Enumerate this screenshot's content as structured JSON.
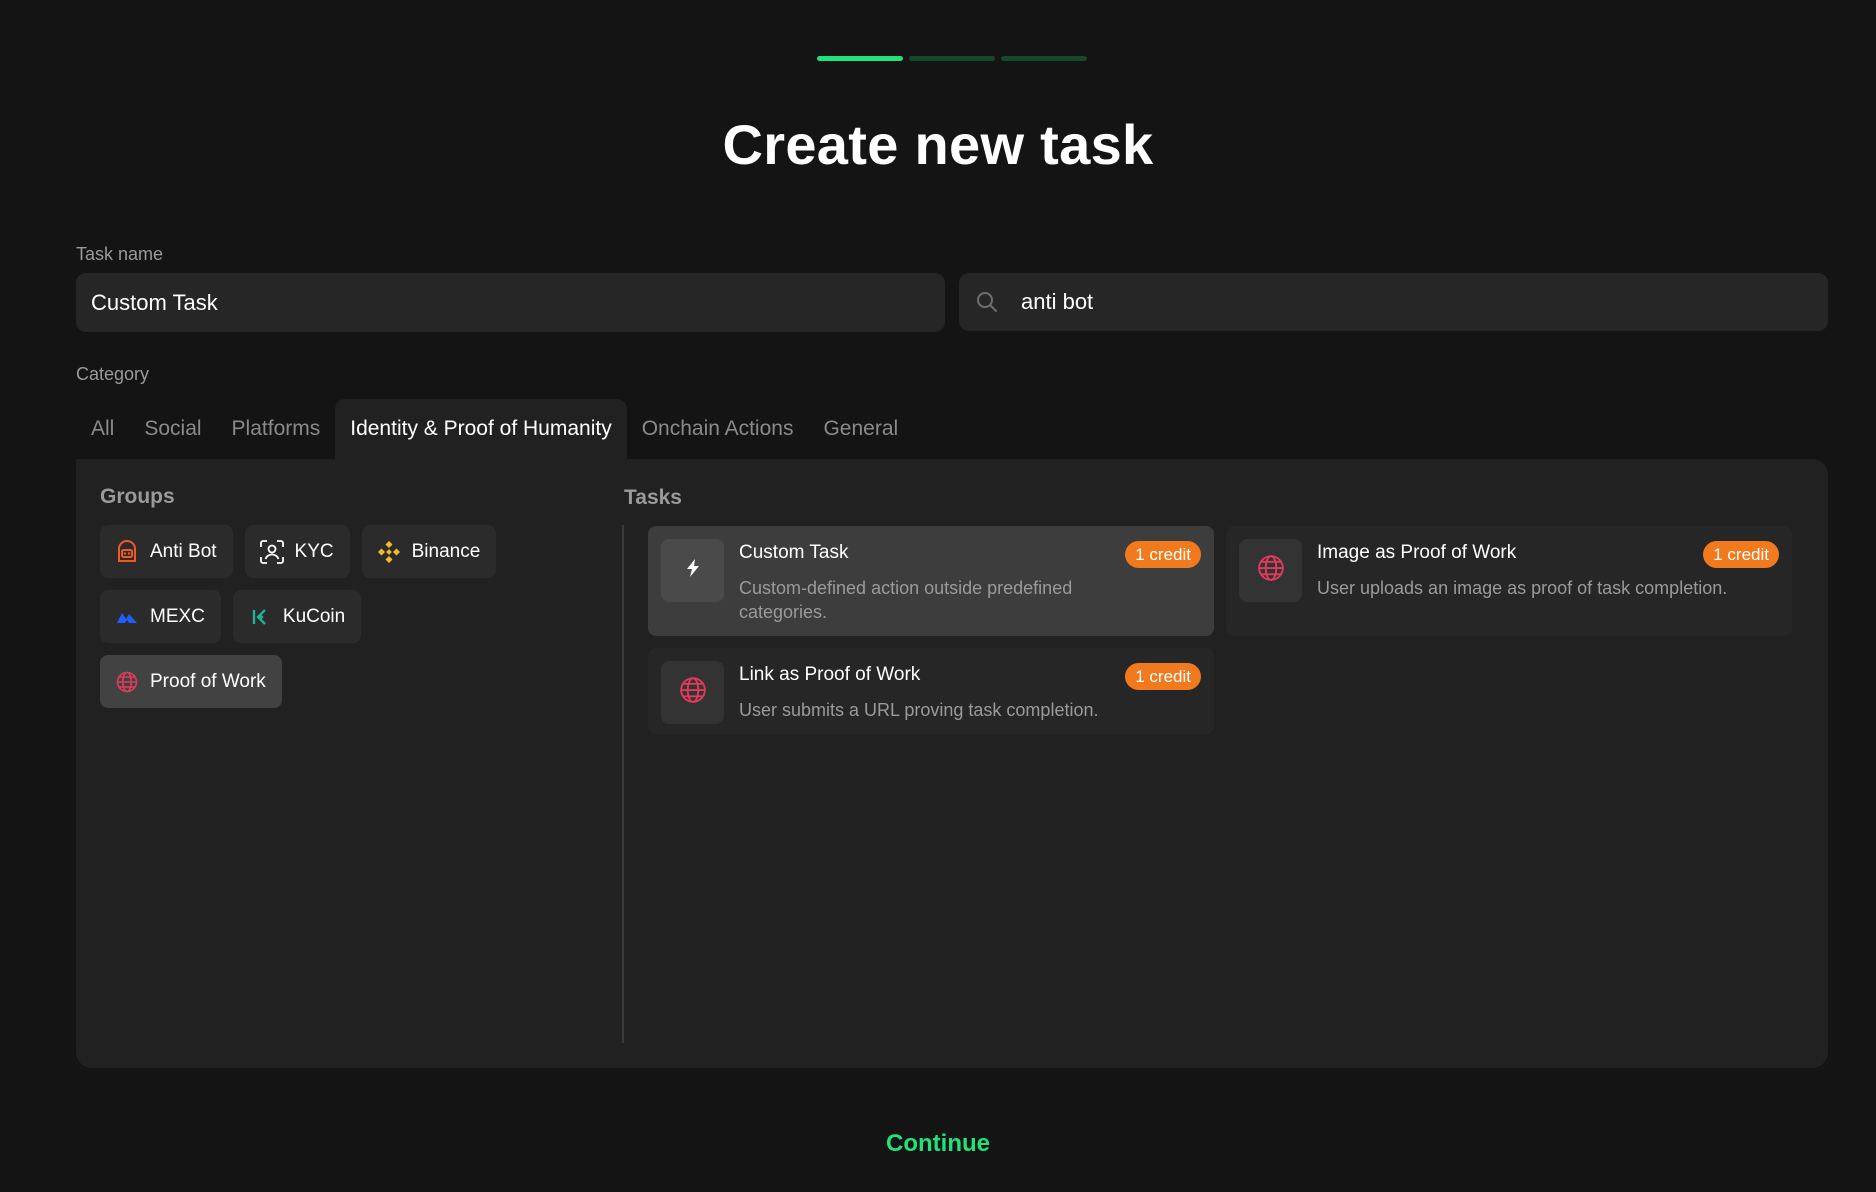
{
  "header": {
    "title": "Create new task",
    "progress_steps": [
      true,
      false,
      false
    ]
  },
  "form": {
    "task_name_label": "Task name",
    "task_name_value": "Custom Task",
    "search_value": "anti bot",
    "category_label": "Category"
  },
  "tabs": [
    {
      "label": "All",
      "active": false
    },
    {
      "label": "Social",
      "active": false
    },
    {
      "label": "Platforms",
      "active": false
    },
    {
      "label": "Identity & Proof of Humanity",
      "active": true
    },
    {
      "label": "Onchain Actions",
      "active": false
    },
    {
      "label": "General",
      "active": false
    }
  ],
  "groups": {
    "title": "Groups",
    "items": [
      {
        "label": "Anti Bot",
        "icon": "robot-icon",
        "active": false
      },
      {
        "label": "KYC",
        "icon": "face-scan-icon",
        "active": false
      },
      {
        "label": "Binance",
        "icon": "binance-icon",
        "active": false
      },
      {
        "label": "MEXC",
        "icon": "mexc-icon",
        "active": false
      },
      {
        "label": "KuCoin",
        "icon": "kucoin-icon",
        "active": false
      },
      {
        "label": "Proof of Work",
        "icon": "globe-icon",
        "active": true
      }
    ]
  },
  "tasks": {
    "title": "Tasks",
    "items": [
      {
        "name": "Custom Task",
        "description": "Custom-defined action outside predefined categories.",
        "badge": "1 credit",
        "icon": "lightning-icon",
        "active": true
      },
      {
        "name": "Image as Proof of Work",
        "description": "User uploads an image as proof of task completion.",
        "badge": "1 credit",
        "icon": "globe-icon",
        "active": false
      },
      {
        "name": "Link as Proof of Work",
        "description": "User submits a URL proving task completion.",
        "badge": "1 credit",
        "icon": "globe-icon",
        "active": false
      }
    ]
  },
  "footer": {
    "continue_label": "Continue"
  },
  "colors": {
    "accent": "#1fe27a",
    "badge": "#f07a1d",
    "background": "#141414",
    "panel": "#212121"
  }
}
